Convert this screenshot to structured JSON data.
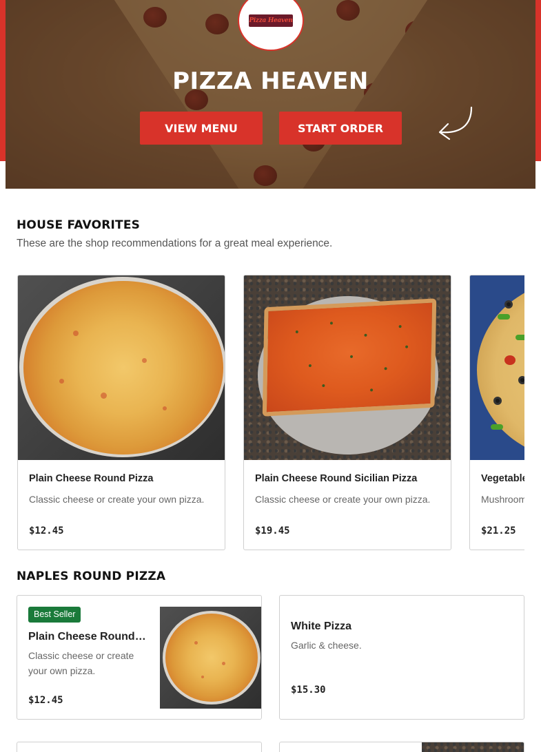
{
  "hero": {
    "logo_text": "Pizza Heaven",
    "title": "PIZZA HEAVEN",
    "view_menu_label": "VIEW MENU",
    "start_order_label": "START ORDER",
    "arrow_icon": "curved-arrow-left-icon"
  },
  "favorites": {
    "title": "HOUSE FAVORITES",
    "subtitle": "These are the shop recommendations for a great meal experience.",
    "items": [
      {
        "name": "Plain Cheese Round Pizza",
        "description": "Classic cheese or create your own pizza.",
        "price": "$12.45"
      },
      {
        "name": "Plain Cheese Round Sicilian Pizza",
        "description": "Classic cheese or create your own pizza.",
        "price": "$19.45"
      },
      {
        "name": "Vegetable",
        "description": "Mushroom tomatoes.",
        "price": "$21.25"
      }
    ]
  },
  "naples": {
    "title": "NAPLES ROUND PIZZA",
    "items": [
      {
        "badge": "Best Seller",
        "name": "Plain Cheese Round…",
        "description": "Classic cheese or create your own pizza.",
        "price": "$12.45"
      },
      {
        "name": "White Pizza",
        "description": "Garlic & cheese.",
        "price": "$15.30"
      }
    ]
  },
  "colors": {
    "brand_red": "#d8332a",
    "badge_green": "#1a7a3a"
  }
}
